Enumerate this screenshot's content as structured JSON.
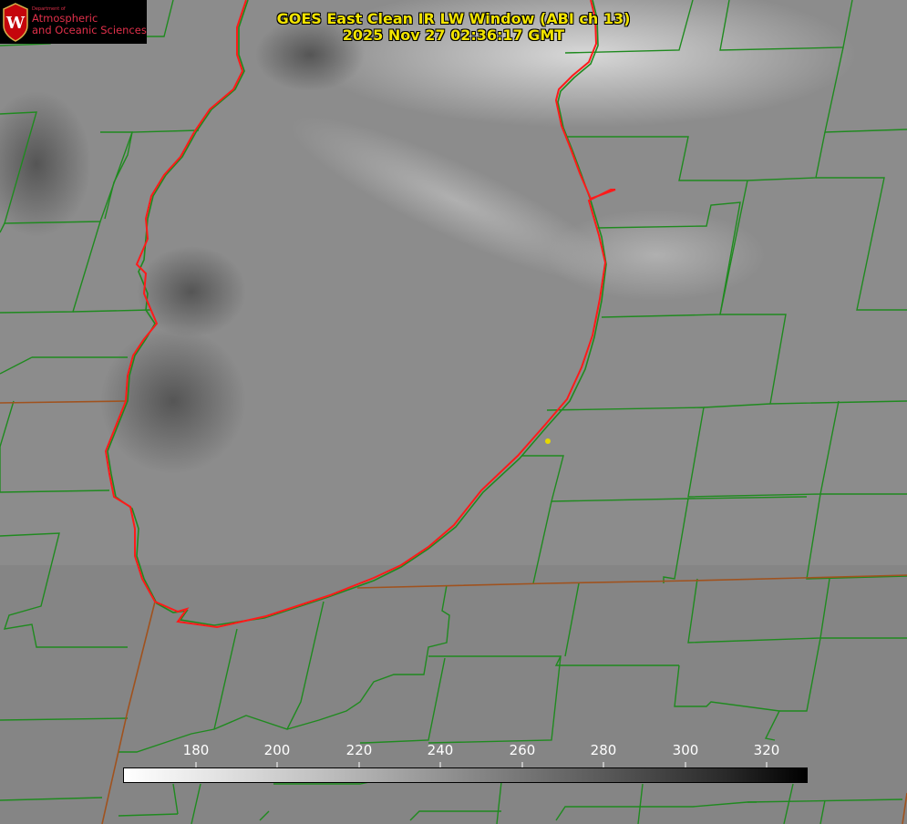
{
  "header": {
    "title_line1": "GOES East Clean IR LW Window (ABI ch 13)",
    "title_line2": "2025 Nov 27 02:36:17 GMT"
  },
  "logo": {
    "department": "Department of",
    "line1": "Atmospheric",
    "line2": "and Oceanic Sciences",
    "seal_letter": "W"
  },
  "colorbar": {
    "ticks": [
      "180",
      "200",
      "220",
      "240",
      "260",
      "280",
      "300",
      "320"
    ],
    "gradient_from": "#ffffff",
    "gradient_to": "#000000"
  },
  "colors": {
    "county_lines": "#1f8a1f",
    "state_lines": "#a0521e",
    "lake_outline": "#ff1a1a",
    "title_text": "#f2e400",
    "location_marker": "#e6d800"
  }
}
